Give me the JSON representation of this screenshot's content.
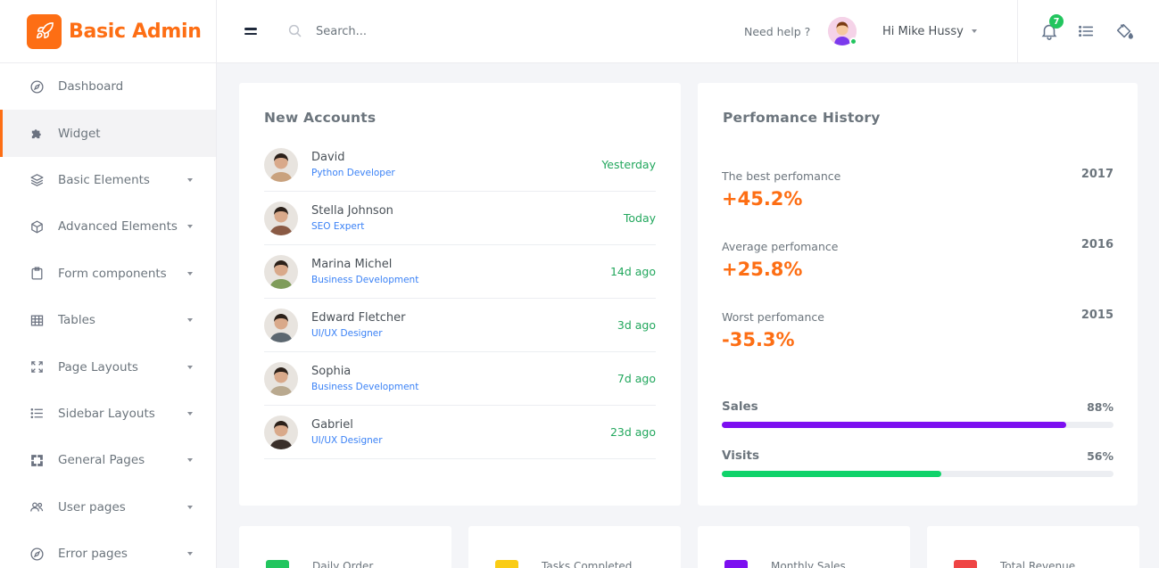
{
  "brand": {
    "name": "Basic Admin",
    "color": "#fd6e14"
  },
  "sidebar": {
    "items": [
      {
        "label": "Dashboard",
        "icon": "compass-icon",
        "has_caret": false,
        "active": false
      },
      {
        "label": "Widget",
        "icon": "puzzle-icon",
        "has_caret": false,
        "active": true
      },
      {
        "label": "Basic Elements",
        "icon": "layers-icon",
        "has_caret": true,
        "active": false
      },
      {
        "label": "Advanced Elements",
        "icon": "cube-icon",
        "has_caret": true,
        "active": false
      },
      {
        "label": "Form components",
        "icon": "clipboard-icon",
        "has_caret": true,
        "active": false
      },
      {
        "label": "Tables",
        "icon": "table-icon",
        "has_caret": true,
        "active": false
      },
      {
        "label": "Page Layouts",
        "icon": "expand-icon",
        "has_caret": true,
        "active": false
      },
      {
        "label": "Sidebar Layouts",
        "icon": "list-icon",
        "has_caret": true,
        "active": false
      },
      {
        "label": "General Pages",
        "icon": "crop-icon",
        "has_caret": true,
        "active": false
      },
      {
        "label": "User pages",
        "icon": "users-icon",
        "has_caret": true,
        "active": false
      },
      {
        "label": "Error pages",
        "icon": "compass-icon",
        "has_caret": true,
        "active": false
      }
    ]
  },
  "header": {
    "search_placeholder": "Search...",
    "help_text": "Need help ?",
    "user_greeting": "Hi Mike Hussy",
    "notification_count": "7"
  },
  "accounts": {
    "title": "New Accounts",
    "rows": [
      {
        "name": "David",
        "role": "Python Developer",
        "time": "Yesterday",
        "avatar_color": "#c9a27e"
      },
      {
        "name": "Stella Johnson",
        "role": "SEO Expert",
        "time": "Today",
        "avatar_color": "#8a5a44"
      },
      {
        "name": "Marina Michel",
        "role": "Business Development",
        "time": "14d ago",
        "avatar_color": "#7f9c5a"
      },
      {
        "name": "Edward Fletcher",
        "role": "UI/UX Designer",
        "time": "3d ago",
        "avatar_color": "#5c6770"
      },
      {
        "name": "Sophia",
        "role": "Business Development",
        "time": "7d ago",
        "avatar_color": "#b9a98f"
      },
      {
        "name": "Gabriel",
        "role": "UI/UX Designer",
        "time": "23d ago",
        "avatar_color": "#3a2f2a"
      }
    ]
  },
  "performance": {
    "title": "Perfomance History",
    "metrics": [
      {
        "label": "The best perfomance",
        "year": "2017",
        "value": "+45.2%"
      },
      {
        "label": "Average perfomance",
        "year": "2016",
        "value": "+25.8%"
      },
      {
        "label": "Worst perfomance",
        "year": "2015",
        "value": "-35.3%"
      }
    ],
    "bars": [
      {
        "label": "Sales",
        "percent_text": "88%",
        "percent": 88,
        "color": "#7c0ff0"
      },
      {
        "label": "Visits",
        "percent_text": "56%",
        "percent": 56,
        "color": "#10d36a"
      }
    ]
  },
  "stats": [
    {
      "label": "Daily Order",
      "color": "#22c55e"
    },
    {
      "label": "Tasks Completed",
      "color": "#facc15"
    },
    {
      "label": "Monthly Sales",
      "color": "#7c0ff0"
    },
    {
      "label": "Total Revenue",
      "color": "#ef4444"
    }
  ]
}
